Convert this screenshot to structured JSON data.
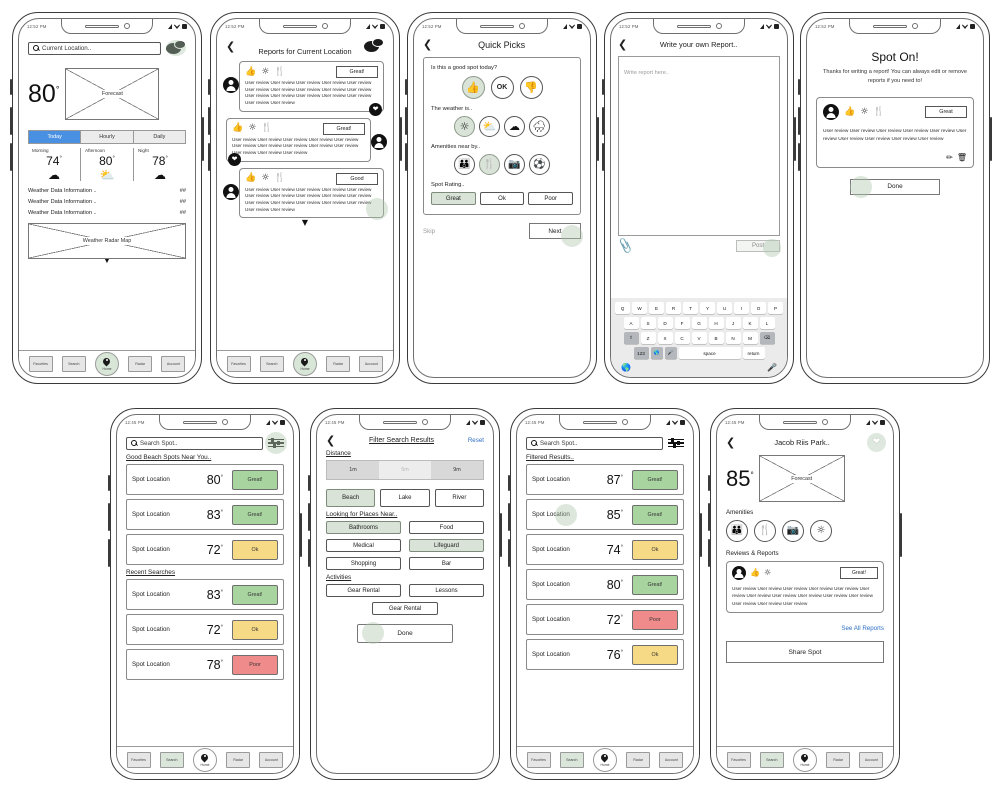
{
  "meta": {
    "status_time_top": "12:52 PM",
    "status_time_bottom": "12:45 PM"
  },
  "colors": {
    "great": "#a8d4a0",
    "ok": "#f7da85",
    "poor": "#ef8b8b",
    "selected": "#d9e3d7",
    "accent_blue": "#2d6fc4",
    "today_tab": "#4a90e2"
  },
  "screens": {
    "home_weather": {
      "search_placeholder": "Current Location..",
      "chat_icon": "chat-bubbles-icon",
      "temperature": "80",
      "degree": "°",
      "forecast_box_label": "Forecast",
      "tabs": [
        "Today",
        "Hourly",
        "Daily"
      ],
      "active_tab": "Today",
      "day_parts": [
        {
          "label": "Morning",
          "temp": "74",
          "icon": "cloud-icon"
        },
        {
          "label": "Afternoon",
          "temp": "80",
          "icon": "partly-cloudy-icon"
        },
        {
          "label": "Night",
          "temp": "78",
          "icon": "cloud-icon"
        }
      ],
      "data_rows": [
        {
          "label": "Weather Data Information ..",
          "value": "##"
        },
        {
          "label": "Weather Data Information ..",
          "value": "##"
        },
        {
          "label": "Weather Data Information ..",
          "value": "##"
        }
      ],
      "radar_label": "Weather Radar Map"
    },
    "reports": {
      "title": "Reports for Current Location",
      "back_icon": "back-chevron-icon",
      "chat_icon": "chat-bubbles-icon",
      "reviews": [
        {
          "rating": "Great!",
          "icons": [
            "thumbs-up-icon",
            "sun-icon",
            "utensils-icon"
          ],
          "text": "User review User review User review User review User review User review User review User review User review User review User review User review User review User review User review User review User review",
          "avatar_side": "left",
          "action_icon": "heart-icon"
        },
        {
          "rating": "Great!",
          "icons": [
            "thumbs-up-icon",
            "sun-icon",
            "utensils-icon"
          ],
          "text": "User review User review User review User review User review User review User review User review User review User review User review User review User review",
          "avatar_side": "right",
          "action_icon": "heart-icon"
        },
        {
          "rating": "Good",
          "icons": [
            "thumbs-up-icon",
            "sun-icon",
            "utensils-icon"
          ],
          "text": "User review User review User review User review User review User review User review User review User review User review User review User review User review User review User review User review User review",
          "avatar_side": "left",
          "action_icon": "plus-icon"
        }
      ]
    },
    "quick_picks": {
      "title": "Quick Picks",
      "back_icon": "back-chevron-icon",
      "q1": "Is this a good spot today?",
      "q1_options": [
        {
          "label": "",
          "icon": "thumbs-up-icon",
          "selected": true
        },
        {
          "label": "OK",
          "icon": "",
          "selected": false
        },
        {
          "label": "",
          "icon": "thumbs-down-icon",
          "selected": false
        }
      ],
      "q2": "The weather is..",
      "q2_options": [
        {
          "icon": "sun-icon",
          "selected": true
        },
        {
          "icon": "partly-cloudy-icon",
          "selected": false
        },
        {
          "icon": "cloud-icon",
          "selected": false
        },
        {
          "icon": "rain-cloud-icon",
          "selected": false
        }
      ],
      "q3": "Amenities near by..",
      "q3_options": [
        {
          "icon": "restroom-icon",
          "selected": false
        },
        {
          "icon": "utensils-icon",
          "selected": true
        },
        {
          "icon": "camera-icon",
          "selected": false
        },
        {
          "icon": "soccer-ball-icon",
          "selected": false
        }
      ],
      "q4": "Spot Rating..",
      "q4_options": [
        {
          "label": "Great",
          "selected": true
        },
        {
          "label": "Ok",
          "selected": false
        },
        {
          "label": "Poor",
          "selected": false
        }
      ],
      "skip_label": "Skip",
      "next_label": "Next"
    },
    "write_report": {
      "title": "Write your own Report..",
      "back_icon": "back-chevron-icon",
      "textarea_placeholder": "Write report here..",
      "attach_icon": "paperclip-icon",
      "post_label": "Post",
      "keyboard": {
        "row1": [
          "Q",
          "W",
          "E",
          "R",
          "T",
          "Y",
          "U",
          "I",
          "O",
          "P"
        ],
        "row2": [
          "A",
          "S",
          "D",
          "F",
          "G",
          "H",
          "J",
          "K",
          "L"
        ],
        "row3": [
          "⇧",
          "Z",
          "X",
          "C",
          "V",
          "B",
          "N",
          "M",
          "⌫"
        ],
        "row4": [
          "123",
          "🌐",
          "🎙",
          "space",
          "return"
        ],
        "globe_icon": "globe-icon",
        "mic_icon": "microphone-icon"
      }
    },
    "spot_on": {
      "title": "Spot On!",
      "subtitle": "Thanks for writing a report! You can always edit or remove reports if you need to!",
      "rating": "Great",
      "icons": [
        "thumbs-up-icon",
        "sun-icon",
        "utensils-icon"
      ],
      "review_text": "User review User review User review User review User review User review User review User review User review User review",
      "edit_icon": "pencil-icon",
      "delete_icon": "trash-icon",
      "done_label": "Done"
    },
    "search": {
      "search_placeholder": "Search Spot..",
      "filter_icon": "sliders-icon",
      "section1": "Good Beach Spots Near You..",
      "results1": [
        {
          "name": "Spot Location",
          "temp": "80",
          "badge": "Great!",
          "badge_color": "great"
        },
        {
          "name": "Spot Location",
          "temp": "83",
          "badge": "Great!",
          "badge_color": "great"
        },
        {
          "name": "Spot Location",
          "temp": "72",
          "badge": "Ok",
          "badge_color": "ok"
        }
      ],
      "section2": "Recent Searches",
      "results2": [
        {
          "name": "Spot Location",
          "temp": "83",
          "badge": "Great!",
          "badge_color": "great"
        },
        {
          "name": "Spot Location",
          "temp": "72",
          "badge": "Ok",
          "badge_color": "ok"
        },
        {
          "name": "Spot Location",
          "temp": "78",
          "badge": "Poor",
          "badge_color": "poor"
        }
      ]
    },
    "filters": {
      "title": "Filter Search Results",
      "back_icon": "back-chevron-icon",
      "reset_label": "Reset",
      "distance_label": "Distance",
      "distance_options": [
        {
          "label": "1m",
          "selected": true
        },
        {
          "label": "5m",
          "selected": false
        },
        {
          "label": "9m",
          "selected": true
        }
      ],
      "water_options": [
        {
          "label": "Beach",
          "selected": true
        },
        {
          "label": "Lake",
          "selected": false
        },
        {
          "label": "River",
          "selected": false
        }
      ],
      "places_label": "Looking for Places Near..",
      "places_options": [
        {
          "label": "Bathrooms",
          "selected": true
        },
        {
          "label": "Food",
          "selected": false
        },
        {
          "label": "Medical",
          "selected": false
        },
        {
          "label": "Lifeguard",
          "selected": true
        },
        {
          "label": "Shopping",
          "selected": false
        },
        {
          "label": "Bar",
          "selected": false
        }
      ],
      "activities_label": "Activities",
      "activities_options": [
        {
          "label": "Gear Rental",
          "selected": false
        },
        {
          "label": "Lessons",
          "selected": false
        },
        {
          "label": "Gear Rental",
          "selected": false
        }
      ],
      "done_label": "Done"
    },
    "filtered_results": {
      "search_placeholder": "Search Spot..",
      "filter_icon": "sliders-icon",
      "section": "Filtered Results..",
      "results": [
        {
          "name": "Spot Location",
          "temp": "87",
          "badge": "Great!",
          "badge_color": "great"
        },
        {
          "name": "Spot Location",
          "temp": "85",
          "badge": "Great!",
          "badge_color": "great"
        },
        {
          "name": "Spot Location",
          "temp": "74",
          "badge": "Ok",
          "badge_color": "ok"
        },
        {
          "name": "Spot Location",
          "temp": "80",
          "badge": "Great!",
          "badge_color": "great"
        },
        {
          "name": "Spot Location",
          "temp": "72",
          "badge": "Poor",
          "badge_color": "poor"
        },
        {
          "name": "Spot Location",
          "temp": "76",
          "badge": "Ok",
          "badge_color": "ok"
        }
      ]
    },
    "spot_detail": {
      "title": "Jacob Riis Park..",
      "back_icon": "back-chevron-icon",
      "favorite_icon": "heart-icon",
      "temperature": "85",
      "forecast_box_label": "Forecast",
      "amenities_label": "Amenities",
      "amenities": [
        "restroom-icon",
        "utensils-icon",
        "camera-icon",
        "sun-icon"
      ],
      "reviews_label": "Reviews & Reports",
      "review": {
        "rating": "Great!",
        "icons": [
          "thumbs-up-icon",
          "sun-icon"
        ],
        "text": "User review User review User review User review User review User review User review User review User review User review User review User review User review User review"
      },
      "see_all_label": "See All Reports",
      "share_label": "Share Spot"
    },
    "tabbar": {
      "items": [
        "Favorites",
        "Search",
        "Radar",
        "Account"
      ],
      "home_label": "Home",
      "home_icon": "map-pin-icon"
    }
  }
}
